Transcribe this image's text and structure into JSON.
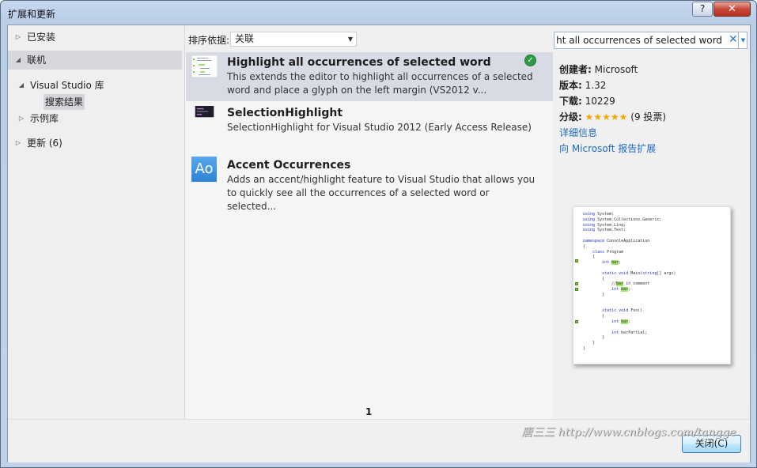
{
  "window": {
    "title": "扩展和更新",
    "help_label": "?",
    "close_label": "✕"
  },
  "nav": {
    "items": [
      {
        "label": "已安装"
      },
      {
        "label": "联机"
      },
      {
        "label": "Visual Studio 库"
      },
      {
        "label": "搜索结果"
      },
      {
        "label": "示例库"
      },
      {
        "label": "更新 (6)"
      }
    ]
  },
  "sort": {
    "label": "排序依据:",
    "value": "关联"
  },
  "search": {
    "value": "Highlight all occurrences of selected word"
  },
  "results": [
    {
      "title": "Highlight all occurrences of selected word",
      "desc": "This extends the editor to highlight all occurrences of a selected word and place a glyph on the left margin (VS2012 v...",
      "installed": true
    },
    {
      "title": "SelectionHighlight",
      "desc": "SelectionHighlight for Visual Studio 2012 (Early Access Release)",
      "installed": false
    },
    {
      "title": "Accent Occurrences",
      "desc": "Adds an accent/highlight feature to Visual Studio that allows you to quickly see all the occurrences of a selected word or selected...",
      "installed": false,
      "icon_text": "Ao"
    }
  ],
  "pager": {
    "current": "1"
  },
  "details": {
    "creator_label": "创建者:",
    "creator": "Microsoft",
    "version_label": "版本:",
    "version": "1.32",
    "downloads_label": "下载:",
    "downloads": "10229",
    "rating_label": "分级:",
    "rating_stars": "★★★★★",
    "rating_votes": "(9 投票)",
    "more_info": "详细信息",
    "report": "向 Microsoft 报告扩展"
  },
  "footer": {
    "close_label": "关闭(C)"
  },
  "watermark": "唐三三 http://www.cnblogs.com/tangge",
  "colors": {
    "accent": "#1e6ac2",
    "selected_row": "#d8dbe3",
    "installed_check": "#2f9a45"
  }
}
